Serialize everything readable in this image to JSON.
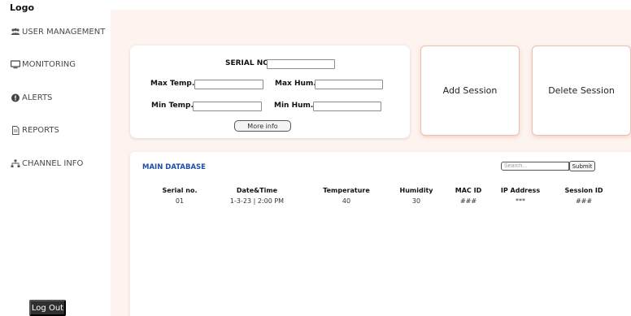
{
  "sidebar": {
    "logo": "Logo",
    "items": [
      {
        "label": "USER MANAGEMENT",
        "icon": "users-icon"
      },
      {
        "label": "MONITORING",
        "icon": "monitor-icon"
      },
      {
        "label": "ALERTS",
        "icon": "alert-icon"
      },
      {
        "label": "REPORTS",
        "icon": "document-icon"
      },
      {
        "label": "CHANNEL INFO",
        "icon": "network-icon"
      }
    ],
    "logout_label": "Log Out"
  },
  "form": {
    "serial_label": "SERIAL NO.",
    "serial_value": "",
    "max_temp_label": "Max Temp.",
    "max_temp_value": "",
    "max_hum_label": "Max Hum.",
    "max_hum_value": "",
    "min_temp_label": "Min Temp.",
    "min_temp_value": "",
    "min_hum_label": "Min Hum.",
    "min_hum_value": "",
    "more_info_label": "More info"
  },
  "actions": {
    "add_session": "Add Session",
    "delete_session": "Delete Session"
  },
  "database": {
    "title": "MAIN DATABASE",
    "search_placeholder": "Search...",
    "submit_label": "Submit",
    "columns": [
      "Serial no.",
      "Date&Time",
      "Temperature",
      "Humidity",
      "MAC ID",
      "IP Address",
      "Session ID"
    ],
    "rows": [
      [
        "01",
        "1-3-23 | 2:00 PM",
        "40",
        "30",
        "###",
        "***",
        "###"
      ]
    ]
  },
  "colors": {
    "main_background": "#fdf3ef",
    "db_title": "#1d4fa8",
    "logout_button": "#2f2f2f",
    "action_card_border": "#e8c3b4"
  }
}
